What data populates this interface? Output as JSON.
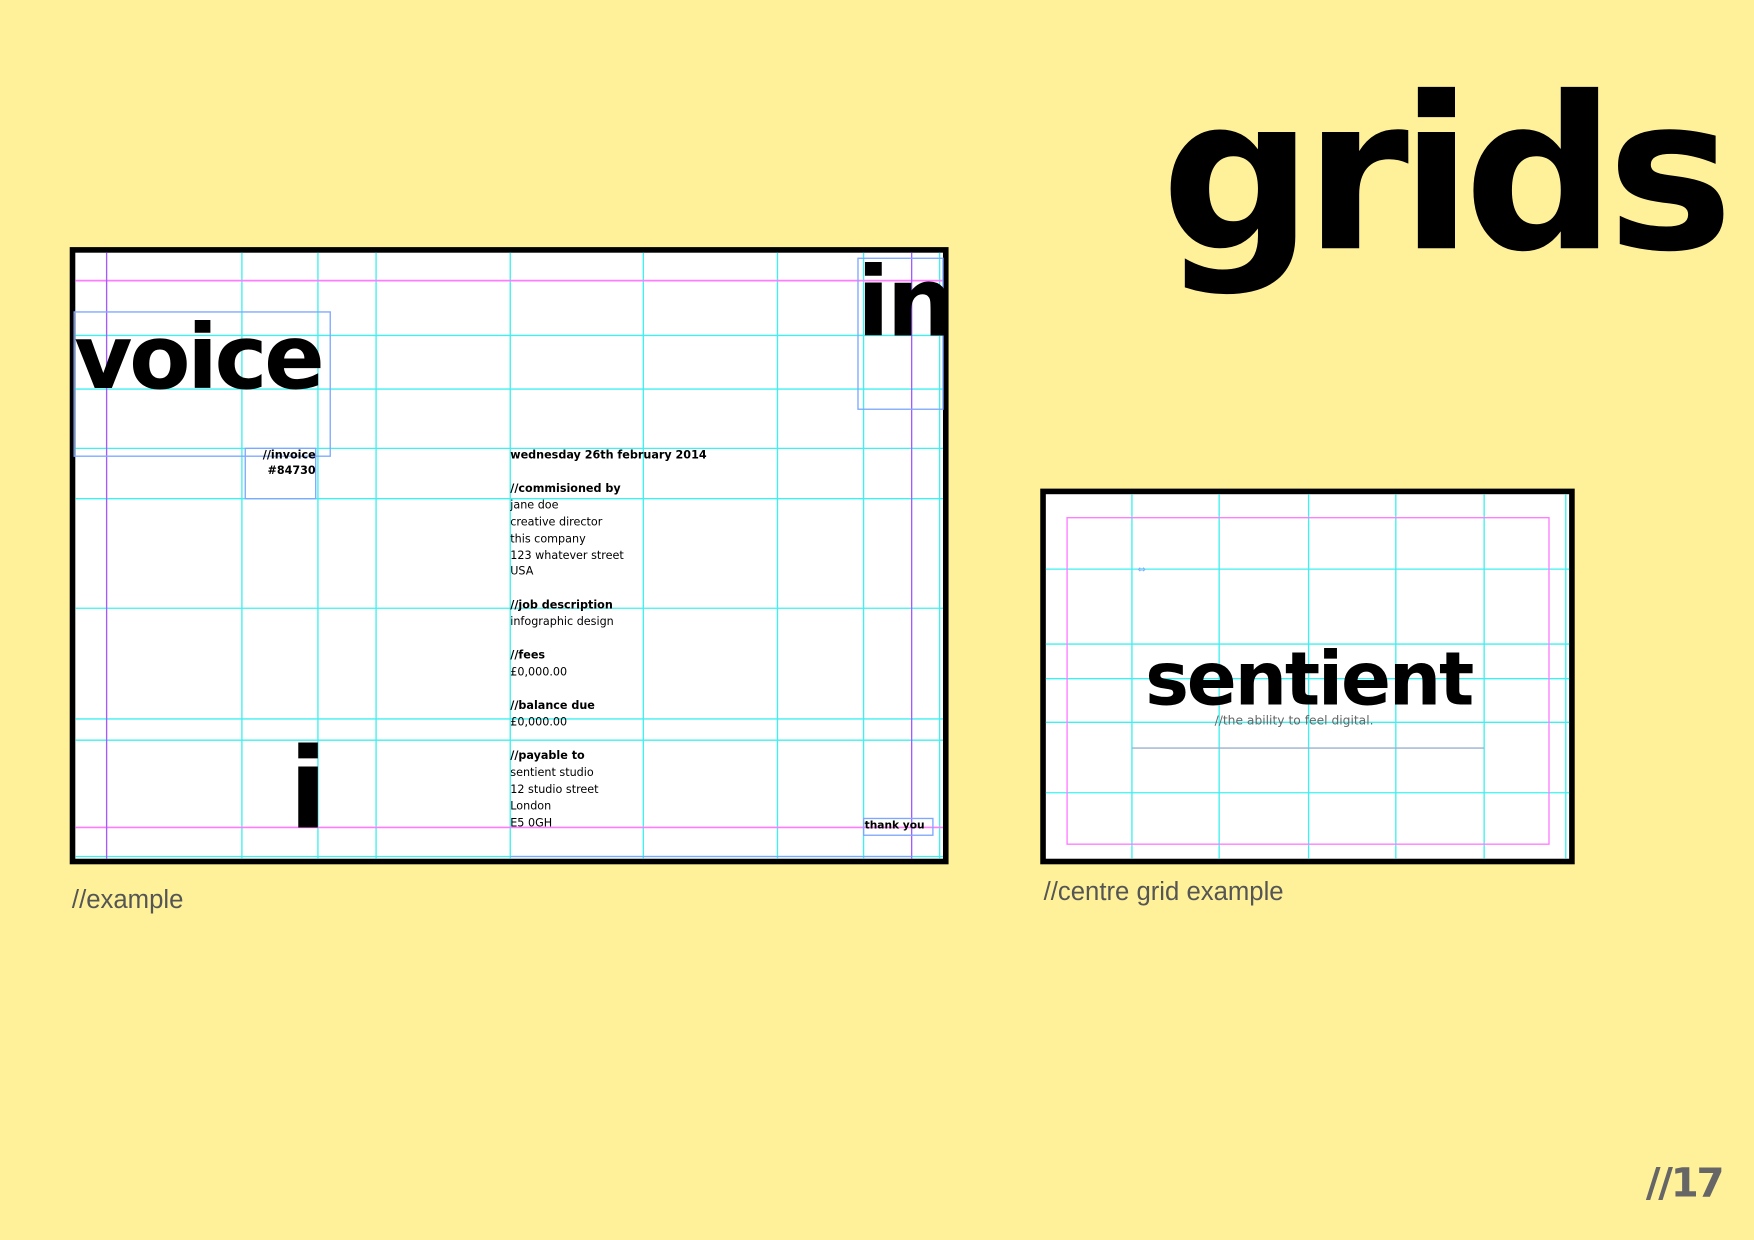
{
  "title": "grids",
  "page_number": "//17",
  "colors": {
    "background": "#fef199",
    "grid": "#3ff0f0",
    "margin": "#ff7cff",
    "frame": "#7ea8ff"
  },
  "example": {
    "caption": "//example",
    "headline_left": "voice",
    "headline_right": "in",
    "figure_letter": "i",
    "invoice_label": "//invoice",
    "invoice_number": "#84730",
    "date": "wednesday 26th february 2014",
    "commissioned_heading": "//commisioned by",
    "commissioned_lines": [
      "jane doe",
      "creative director",
      "this company",
      "123 whatever street",
      "USA"
    ],
    "job_heading": "//job description",
    "job_value": "infographic design",
    "fees_heading": "//fees",
    "fees_value": "£0,000.00",
    "balance_heading": "//balance due",
    "balance_value": "£0,000.00",
    "payable_heading": "//payable to",
    "payable_lines": [
      "sentient studio",
      "12 studio street",
      "London",
      "E5 0GH"
    ],
    "thanks": "thank you"
  },
  "centre_example": {
    "caption": "//centre grid example",
    "wordmark": "sentient",
    "tagline": "//the ability to feel digital."
  }
}
